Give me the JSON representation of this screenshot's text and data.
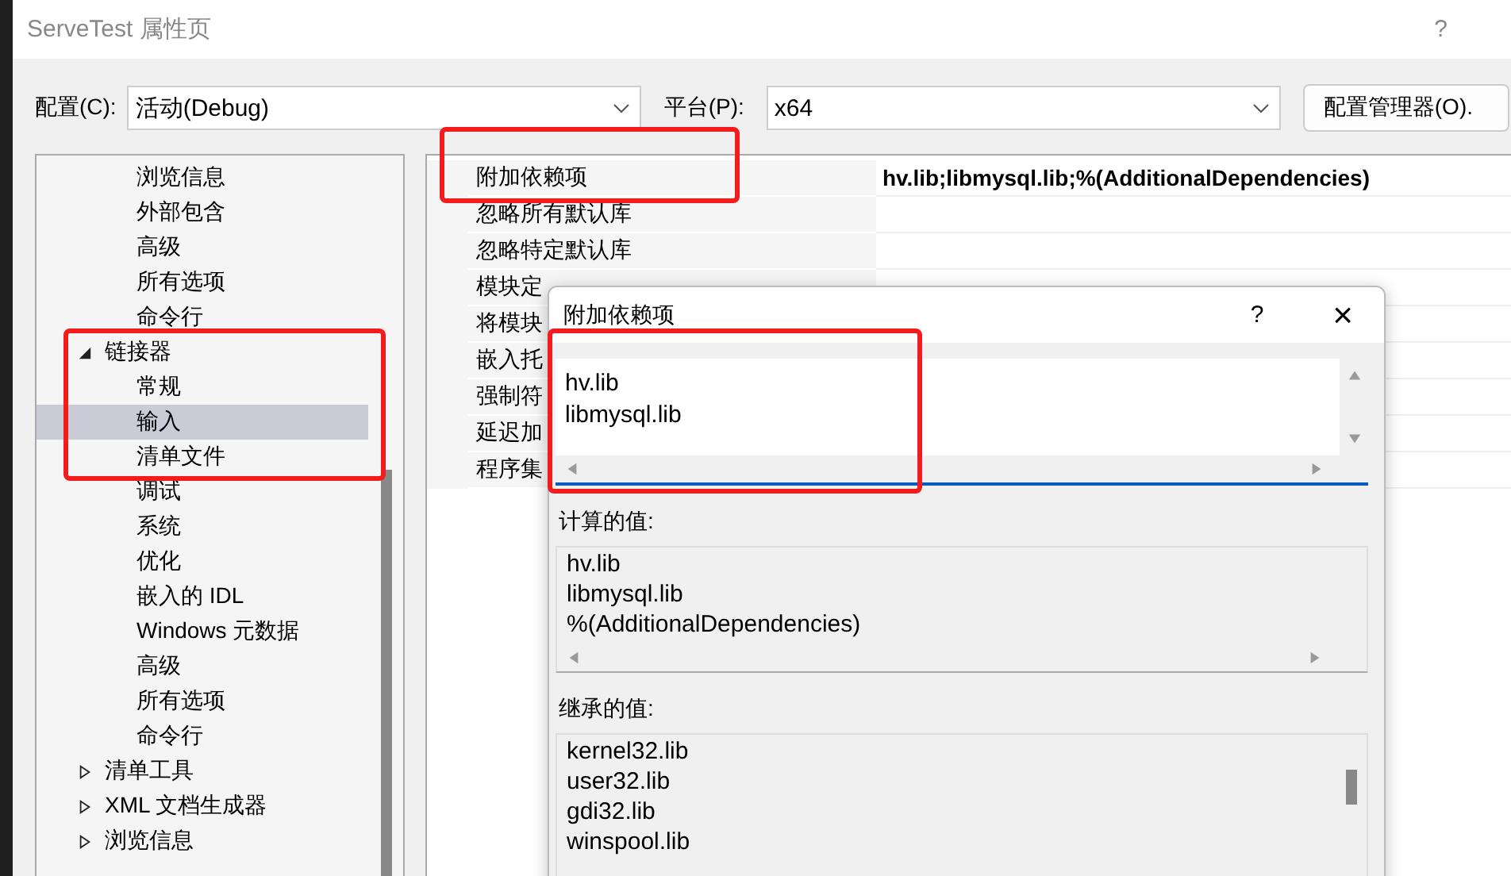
{
  "window": {
    "title": "ServeTest 属性页",
    "help": "?"
  },
  "config_bar": {
    "configuration_label": "配置(C):",
    "configuration_value": "活动(Debug)",
    "platform_label": "平台(P):",
    "platform_value": "x64",
    "manager_button": "配置管理器(O)."
  },
  "tree": {
    "continued_children": [
      {
        "label": "浏览信息",
        "selected": false
      },
      {
        "label": "外部包含",
        "selected": false
      },
      {
        "label": "高级",
        "selected": false
      },
      {
        "label": "所有选项",
        "selected": false
      },
      {
        "label": "命令行",
        "selected": false
      }
    ],
    "nodes": [
      {
        "label": "链接器",
        "expanded": true,
        "selected": false,
        "children": [
          {
            "label": "常规",
            "selected": false
          },
          {
            "label": "输入",
            "selected": true
          },
          {
            "label": "清单文件",
            "selected": false
          },
          {
            "label": "调试",
            "selected": false
          },
          {
            "label": "系统",
            "selected": false
          },
          {
            "label": "优化",
            "selected": false
          },
          {
            "label": "嵌入的 IDL",
            "selected": false
          },
          {
            "label": "Windows 元数据",
            "selected": false
          },
          {
            "label": "高级",
            "selected": false
          },
          {
            "label": "所有选项",
            "selected": false
          },
          {
            "label": "命令行",
            "selected": false
          }
        ]
      },
      {
        "label": "清单工具",
        "expanded": false,
        "selected": false
      },
      {
        "label": "XML 文档生成器",
        "expanded": false,
        "selected": false
      },
      {
        "label": "浏览信息",
        "expanded": false,
        "selected": false
      }
    ]
  },
  "properties": [
    {
      "name": "附加依赖项",
      "value": "hv.lib;libmysql.lib;%(AdditionalDependencies)"
    },
    {
      "name": "忽略所有默认库"
    },
    {
      "name": "忽略特定默认库"
    },
    {
      "name": "模块定"
    },
    {
      "name": "将模块"
    },
    {
      "name": "嵌入托"
    },
    {
      "name": "强制符"
    },
    {
      "name": "延迟加"
    },
    {
      "name": "程序集"
    }
  ],
  "dialog": {
    "title": "附加依赖项",
    "help": "?",
    "close": "×",
    "value_lines": [
      "hv.lib",
      "libmysql.lib"
    ],
    "computed_label": "计算的值:",
    "computed_lines": [
      "hv.lib",
      "libmysql.lib",
      "%(AdditionalDependencies)"
    ],
    "inherited_label": "继承的值:",
    "inherited_lines": [
      "kernel32.lib",
      "user32.lib",
      "gdi32.lib",
      "winspool.lib"
    ]
  }
}
